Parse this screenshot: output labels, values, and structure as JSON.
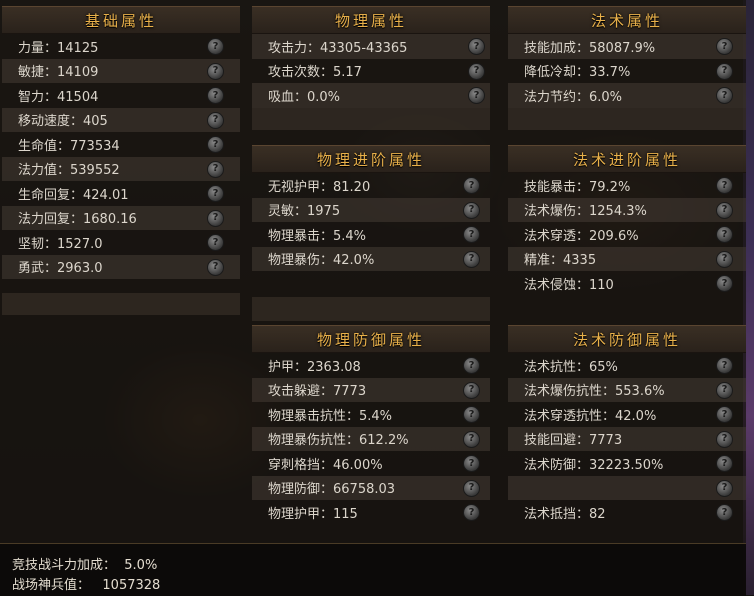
{
  "sections": {
    "basic": {
      "title": "基础属性",
      "rows": [
        "力量：14125",
        "敏捷：14109",
        "智力：41504",
        "移动速度：405",
        "生命值：773534",
        "法力值：539552",
        "生命回复：424.01",
        "法力回复：1680.16",
        "坚韧：1527.0",
        "勇武：2963.0"
      ]
    },
    "phys": {
      "title": "物理属性",
      "rows": [
        "攻击力：43305-43365",
        "攻击次数：5.17",
        "吸血：0.0%"
      ]
    },
    "magic": {
      "title": "法术属性",
      "rows": [
        "技能加成：58087.9%",
        "降低冷却：33.7%",
        "法力节约：6.0%"
      ]
    },
    "phys_adv": {
      "title": "物理进阶属性",
      "rows": [
        "无视护甲：81.20",
        "灵敏：1975",
        "物理暴击：5.4%",
        "物理暴伤：42.0%"
      ]
    },
    "magic_adv": {
      "title": "法术进阶属性",
      "rows": [
        "技能暴击：79.2%",
        "法术爆伤：1254.3%",
        "法术穿透：209.6%",
        "精准：4335",
        "法术侵蚀：110"
      ]
    },
    "phys_def": {
      "title": "物理防御属性",
      "rows": [
        "护甲：2363.08",
        "攻击躲避：7773",
        "物理暴击抗性：5.4%",
        "物理暴伤抗性：612.2%",
        "穿刺格挡：46.00%",
        "物理防御：66758.03",
        "物理护甲：115"
      ]
    },
    "magic_def": {
      "title": "法术防御属性",
      "rows": [
        "法术抗性：65%",
        "法术爆伤抗性：553.6%",
        "法术穿透抗性：42.0%",
        "技能回避：7773",
        "法术防御：32223.50%",
        "",
        "法术抵挡：82"
      ]
    }
  },
  "help_icon_glyph": "?",
  "bottom": {
    "line1": "竞技战斗力加成：  5.0%",
    "line2": "战场神兵值：   1057328"
  },
  "colors": {
    "title_gold": "#e8b04a",
    "text": "#dcd6cc",
    "row_alt": "#463c34",
    "panel_bg": "#181411"
  }
}
